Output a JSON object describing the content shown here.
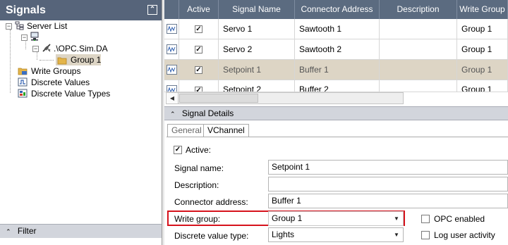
{
  "left_panel": {
    "title": "Signals",
    "tree": {
      "server_list": "Server List",
      "server_name": ".\\OPC.Sim.DA",
      "group": "Group 1",
      "write_groups": "Write Groups",
      "discrete_values": "Discrete Values",
      "discrete_value_types": "Discrete Value Types"
    },
    "filter_label": "Filter"
  },
  "grid": {
    "columns": [
      "Active",
      "Signal Name",
      "Connector Address",
      "Description",
      "Write Group"
    ],
    "rows": [
      {
        "active": true,
        "signal_name": "Servo 1",
        "connector_address": "Sawtooth 1",
        "description": "",
        "write_group": "Group 1",
        "selected": false
      },
      {
        "active": true,
        "signal_name": "Servo 2",
        "connector_address": "Sawtooth 2",
        "description": "",
        "write_group": "Group 1",
        "selected": false
      },
      {
        "active": true,
        "signal_name": "Setpoint 1",
        "connector_address": "Buffer 1",
        "description": "",
        "write_group": "Group 1",
        "selected": true
      },
      {
        "active": true,
        "signal_name": "Setpoint 2",
        "connector_address": "Buffer 2",
        "description": "",
        "write_group": "Group 1",
        "selected": false
      }
    ]
  },
  "details": {
    "header": "Signal Details",
    "tabs": [
      "General",
      "VChannel"
    ],
    "active_label": "Active:",
    "active_checked": true,
    "signal_name_label": "Signal name:",
    "signal_name_value": "Setpoint 1",
    "description_label": "Description:",
    "description_value": "",
    "connector_address_label": "Connector address:",
    "connector_address_value": "Buffer 1",
    "write_group_label": "Write group:",
    "write_group_value": "Group 1",
    "discrete_value_type_label": "Discrete value type:",
    "discrete_value_type_value": "Lights",
    "opc_enabled_label": "OPC enabled",
    "log_user_activity_label": "Log user activity"
  },
  "colors": {
    "header_bg": "#5b6b80",
    "title_bg": "#56647a",
    "selected_row": "#ddd5c5",
    "highlight": "#d6121c"
  }
}
